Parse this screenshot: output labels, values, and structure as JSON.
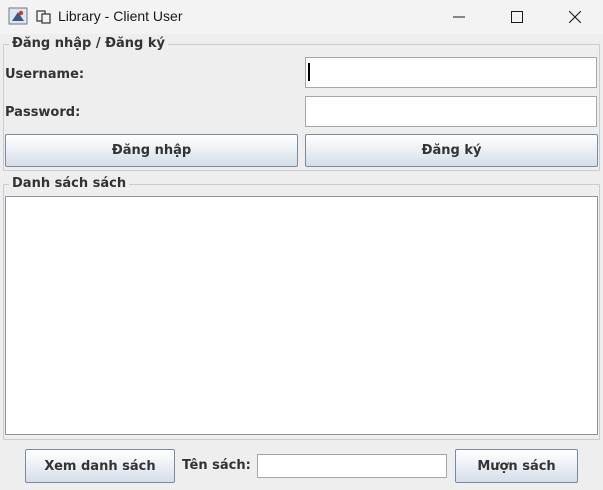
{
  "window": {
    "title": "Library - Client User",
    "controls": [
      "minimize",
      "maximize",
      "close"
    ]
  },
  "login_panel": {
    "legend": "Đăng nhập / Đăng ký",
    "username_label": "Username:",
    "username_value": "",
    "password_label": "Password:",
    "password_value": "",
    "login_button": "Đăng nhập",
    "register_button": "Đăng ký"
  },
  "books_panel": {
    "legend": "Danh sách sách",
    "items": []
  },
  "footer": {
    "view_list_button": "Xem danh sách",
    "book_title_label": "Tên sách:",
    "book_title_value": "",
    "borrow_button": "Mượn sách"
  },
  "icons": {
    "app": "java-app-icon",
    "title_glyph": "duplicate-windows-icon",
    "minimize": "minimize-icon",
    "maximize": "maximize-icon",
    "close": "close-icon"
  },
  "colors": {
    "window_bg": "#eeeeee",
    "titlebar_bg": "#f3f3f3",
    "field_border": "#a3a8ae",
    "button_border": "#7a8aa0",
    "label_text": "#333333"
  }
}
